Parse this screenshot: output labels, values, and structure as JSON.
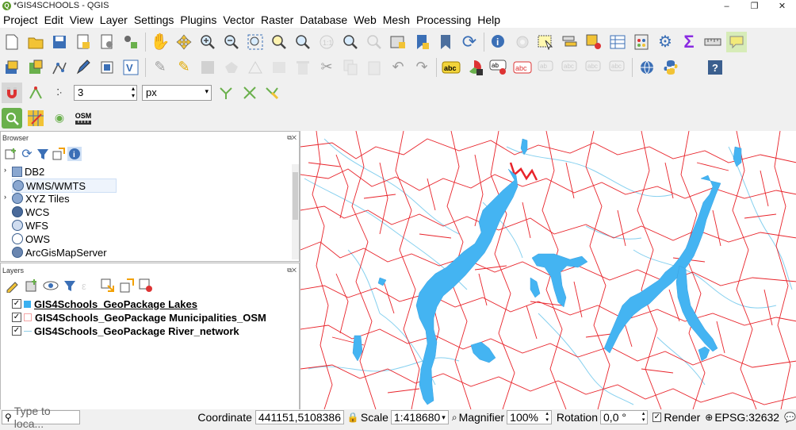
{
  "window": {
    "title": "*GIS4SCHOOLS - QGIS",
    "app_icon": "Q",
    "minimize": "–",
    "maximize": "❐",
    "close": "✕"
  },
  "menu": [
    "Project",
    "Edit",
    "View",
    "Layer",
    "Settings",
    "Plugins",
    "Vector",
    "Raster",
    "Database",
    "Web",
    "Mesh",
    "Processing",
    "Help"
  ],
  "snapping": {
    "tolerance": "3",
    "unit": "px"
  },
  "plugins": {
    "osm_label": "OSM"
  },
  "browser": {
    "title": "Browser",
    "items": [
      {
        "label": "DB2",
        "expandable": true,
        "icon": "db2-icon"
      },
      {
        "label": "WMS/WMTS",
        "expandable": false,
        "icon": "globe-icon"
      },
      {
        "label": "XYZ Tiles",
        "expandable": true,
        "icon": "globe-icon"
      },
      {
        "label": "WCS",
        "expandable": false,
        "icon": "globe-icon"
      },
      {
        "label": "WFS",
        "expandable": false,
        "icon": "globe-icon"
      },
      {
        "label": "OWS",
        "expandable": false,
        "icon": "globe-icon"
      },
      {
        "label": "ArcGisMapServer",
        "expandable": false,
        "icon": "globe-icon"
      }
    ]
  },
  "layers": {
    "title": "Layers",
    "items": [
      {
        "label": "GIS4Schools_GeoPackage Lakes",
        "checked": true,
        "symbol": "#3ab0f0",
        "underline": true
      },
      {
        "label": "GIS4Schools_GeoPackage Municipalities_OSM",
        "checked": true,
        "symbol": "#f4a6a6",
        "underline": false
      },
      {
        "label": "GIS4Schools_GeoPackage River_network",
        "checked": true,
        "symbol": "#8fcde8",
        "underline": false
      }
    ]
  },
  "map": {
    "lake_color": "#44b4f2",
    "border_color": "#e8232a",
    "river_color": "#86d0ef"
  },
  "status": {
    "search_placeholder": "Type to loca...",
    "coordinate_label": "Coordinate",
    "coordinate_value": "441151,5108386",
    "scale_label": "Scale",
    "scale_value": "1:418680",
    "magnifier_label": "Magnifier",
    "magnifier_value": "100%",
    "rotation_label": "Rotation",
    "rotation_value": "0,0 °",
    "render_label": "Render",
    "crs_label": "EPSG:32632"
  }
}
